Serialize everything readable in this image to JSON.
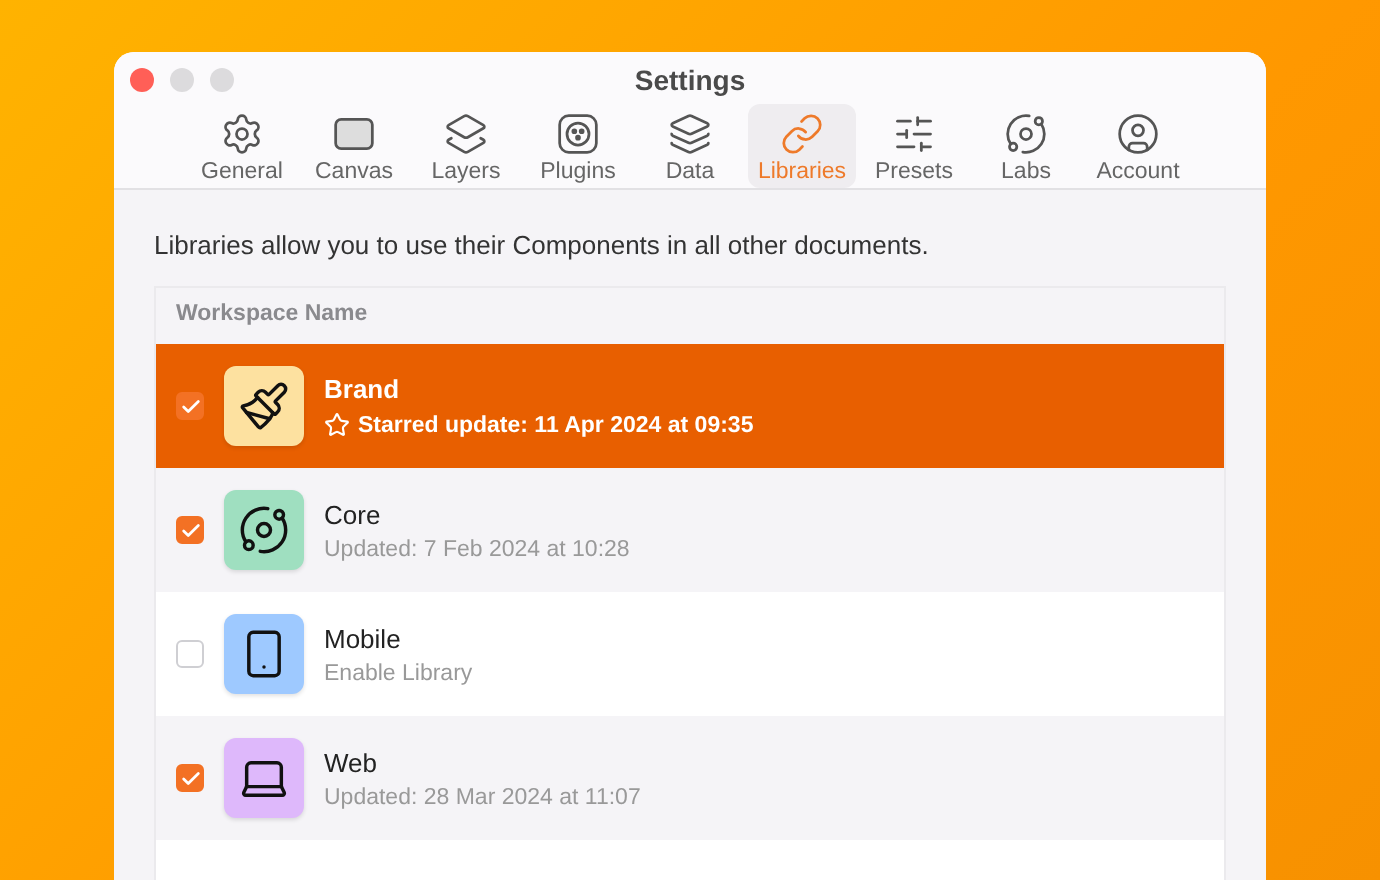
{
  "window": {
    "title": "Settings"
  },
  "tabs": [
    {
      "label": "General",
      "kind": "gear",
      "selected": false
    },
    {
      "label": "Canvas",
      "kind": "canvas",
      "selected": false
    },
    {
      "label": "Layers",
      "kind": "layers",
      "selected": false
    },
    {
      "label": "Plugins",
      "kind": "plug",
      "selected": false
    },
    {
      "label": "Data",
      "kind": "stack",
      "selected": false
    },
    {
      "label": "Libraries",
      "kind": "link",
      "selected": true
    },
    {
      "label": "Presets",
      "kind": "sliders",
      "selected": false
    },
    {
      "label": "Labs",
      "kind": "orbit",
      "selected": false
    },
    {
      "label": "Account",
      "kind": "user",
      "selected": false
    }
  ],
  "description": "Libraries allow you to use their Components in all other documents.",
  "table": {
    "columns": [
      "Workspace Name"
    ],
    "rows": [
      {
        "name": "Brand",
        "subtitle": "Starred update: 11 Apr 2024 at 09:35",
        "starred": true,
        "checked": true,
        "selected": true,
        "kind": "brush",
        "color": "#fde1a0"
      },
      {
        "name": "Core",
        "subtitle": "Updated: 7 Feb 2024 at 10:28",
        "starred": false,
        "checked": true,
        "selected": false,
        "kind": "orbit",
        "color": "#9fdfc0"
      },
      {
        "name": "Mobile",
        "subtitle": "Enable Library",
        "starred": false,
        "checked": false,
        "selected": false,
        "kind": "phone",
        "color": "#9ec9ff"
      },
      {
        "name": "Web",
        "subtitle": "Updated: 28 Mar 2024 at 11:07",
        "starred": false,
        "checked": true,
        "selected": false,
        "kind": "laptop",
        "color": "#deb8fb"
      }
    ]
  }
}
